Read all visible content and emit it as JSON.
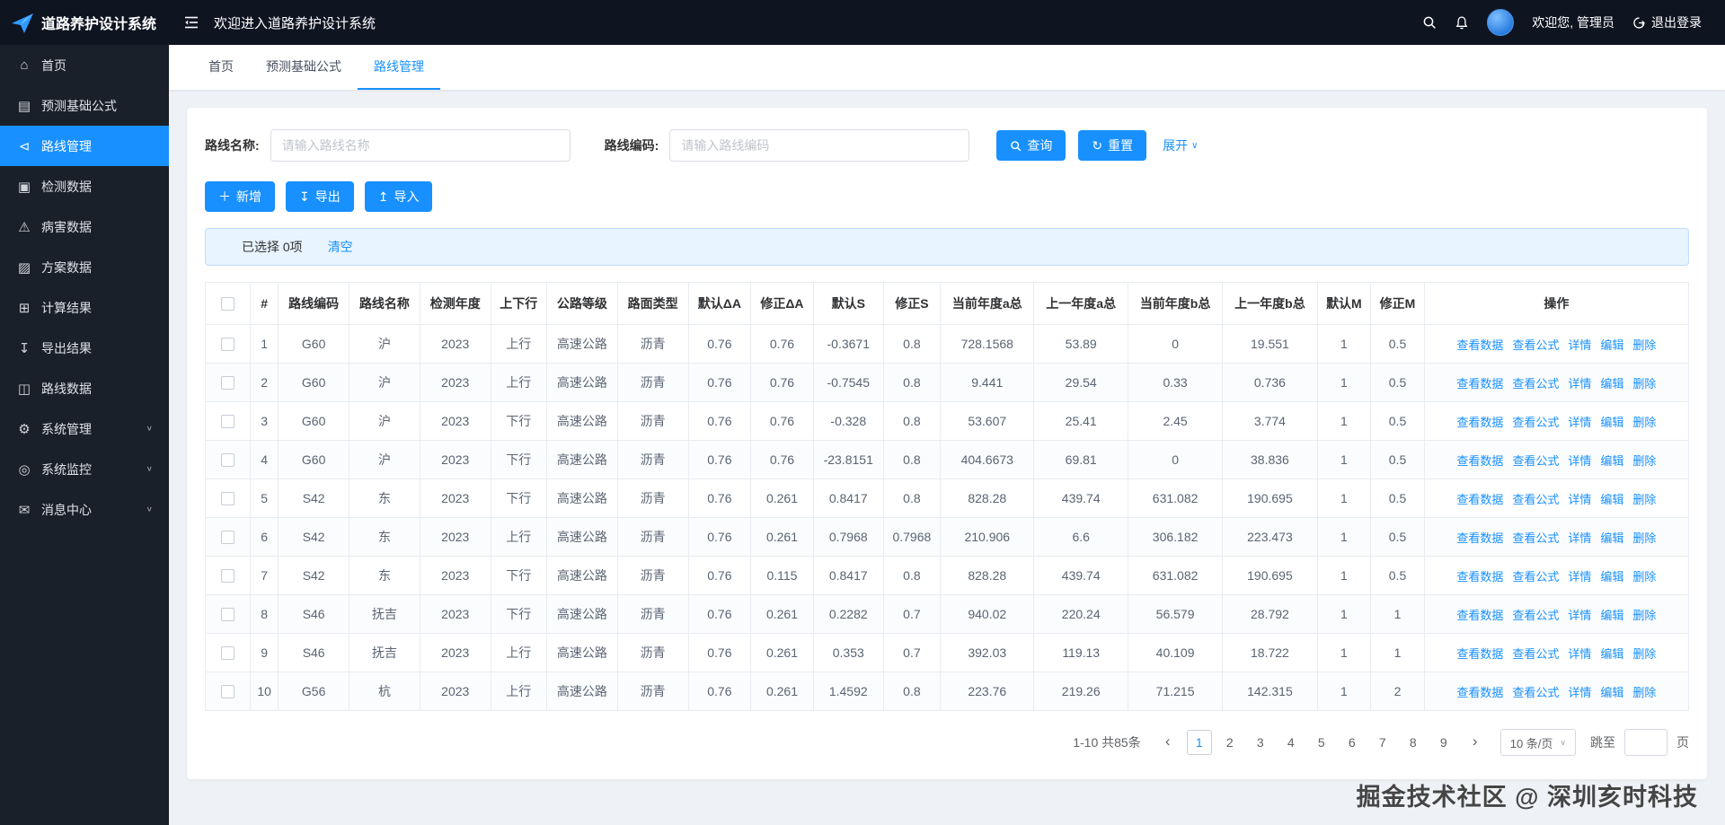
{
  "app": {
    "title": "道路养护设计系统",
    "welcome": "欢迎进入道路养护设计系统",
    "greeting": "欢迎您, 管理员",
    "logout_label": "退出登录"
  },
  "sidebar": {
    "items": [
      {
        "id": "home",
        "label": "首页",
        "icon": "home-icon",
        "glyph": "⌂"
      },
      {
        "id": "formula",
        "label": "预测基础公式",
        "icon": "formula-icon",
        "glyph": "▤"
      },
      {
        "id": "route-mgmt",
        "label": "路线管理",
        "icon": "route-icon",
        "glyph": "⊲",
        "active": true
      },
      {
        "id": "detection",
        "label": "检测数据",
        "icon": "detection-icon",
        "glyph": "▣"
      },
      {
        "id": "disease",
        "label": "病害数据",
        "icon": "disease-icon",
        "glyph": "⚠"
      },
      {
        "id": "plan",
        "label": "方案数据",
        "icon": "plan-icon",
        "glyph": "▨"
      },
      {
        "id": "calc-result",
        "label": "计算结果",
        "icon": "calc-icon",
        "glyph": "⊞"
      },
      {
        "id": "export-result",
        "label": "导出结果",
        "icon": "export-icon",
        "glyph": "↧"
      },
      {
        "id": "route-data",
        "label": "路线数据",
        "icon": "route-data-icon",
        "glyph": "◫"
      },
      {
        "id": "sys-mgmt",
        "label": "系统管理",
        "icon": "gear-icon",
        "glyph": "⚙",
        "expandable": true
      },
      {
        "id": "sys-monitor",
        "label": "系统监控",
        "icon": "monitor-icon",
        "glyph": "◎",
        "expandable": true
      },
      {
        "id": "message-center",
        "label": "消息中心",
        "icon": "message-icon",
        "glyph": "✉",
        "expandable": true
      }
    ]
  },
  "tabs": [
    {
      "label": "首页"
    },
    {
      "label": "预测基础公式"
    },
    {
      "label": "路线管理",
      "active": true
    }
  ],
  "filters": {
    "name_label": "路线名称:",
    "name_placeholder": "请输入路线名称",
    "code_label": "路线编码:",
    "code_placeholder": "请输入路线编码",
    "search_label": "查询",
    "reset_label": "重置",
    "expand_label": "展开"
  },
  "toolbar": {
    "add_label": "新增",
    "export_label": "导出",
    "import_label": "导入"
  },
  "selection": {
    "text": "已选择 0项",
    "clear_label": "清空"
  },
  "table": {
    "headers": [
      "#",
      "路线编码",
      "路线名称",
      "检测年度",
      "上下行",
      "公路等级",
      "路面类型",
      "默认ΔA",
      "修正ΔA",
      "默认S",
      "修正S",
      "当前年度a总",
      "上一年度a总",
      "当前年度b总",
      "上一年度b总",
      "默认M",
      "修正M",
      "操作"
    ],
    "actions": [
      "查看数据",
      "查看公式",
      "详情",
      "编辑",
      "删除"
    ],
    "action_names": [
      "view-data-link",
      "view-formula-link",
      "detail-link",
      "edit-link",
      "delete-link"
    ],
    "rows": [
      [
        "1",
        "G60",
        "沪",
        "2023",
        "上行",
        "高速公路",
        "沥青",
        "0.76",
        "0.76",
        "-0.3671",
        "0.8",
        "728.1568",
        "53.89",
        "0",
        "19.551",
        "1",
        "0.5"
      ],
      [
        "2",
        "G60",
        "沪",
        "2023",
        "上行",
        "高速公路",
        "沥青",
        "0.76",
        "0.76",
        "-0.7545",
        "0.8",
        "9.441",
        "29.54",
        "0.33",
        "0.736",
        "1",
        "0.5"
      ],
      [
        "3",
        "G60",
        "沪",
        "2023",
        "下行",
        "高速公路",
        "沥青",
        "0.76",
        "0.76",
        "-0.328",
        "0.8",
        "53.607",
        "25.41",
        "2.45",
        "3.774",
        "1",
        "0.5"
      ],
      [
        "4",
        "G60",
        "沪",
        "2023",
        "下行",
        "高速公路",
        "沥青",
        "0.76",
        "0.76",
        "-23.8151",
        "0.8",
        "404.6673",
        "69.81",
        "0",
        "38.836",
        "1",
        "0.5"
      ],
      [
        "5",
        "S42",
        "东",
        "2023",
        "下行",
        "高速公路",
        "沥青",
        "0.76",
        "0.261",
        "0.8417",
        "0.8",
        "828.28",
        "439.74",
        "631.082",
        "190.695",
        "1",
        "0.5"
      ],
      [
        "6",
        "S42",
        "东",
        "2023",
        "上行",
        "高速公路",
        "沥青",
        "0.76",
        "0.261",
        "0.7968",
        "0.7968",
        "210.906",
        "6.6",
        "306.182",
        "223.473",
        "1",
        "0.5"
      ],
      [
        "7",
        "S42",
        "东",
        "2023",
        "下行",
        "高速公路",
        "沥青",
        "0.76",
        "0.115",
        "0.8417",
        "0.8",
        "828.28",
        "439.74",
        "631.082",
        "190.695",
        "1",
        "0.5"
      ],
      [
        "8",
        "S46",
        "抚吉",
        "2023",
        "下行",
        "高速公路",
        "沥青",
        "0.76",
        "0.261",
        "0.2282",
        "0.7",
        "940.02",
        "220.24",
        "56.579",
        "28.792",
        "1",
        "1"
      ],
      [
        "9",
        "S46",
        "抚吉",
        "2023",
        "上行",
        "高速公路",
        "沥青",
        "0.76",
        "0.261",
        "0.353",
        "0.7",
        "392.03",
        "119.13",
        "40.109",
        "18.722",
        "1",
        "1"
      ],
      [
        "10",
        "G56",
        "杭",
        "2023",
        "上行",
        "高速公路",
        "沥青",
        "0.76",
        "0.261",
        "1.4592",
        "0.8",
        "223.76",
        "219.26",
        "71.215",
        "142.315",
        "1",
        "2"
      ]
    ]
  },
  "pagination": {
    "total_text": "1-10 共85条",
    "prev_glyph": "‹",
    "next_glyph": "›",
    "pages": [
      "1",
      "2",
      "3",
      "4",
      "5",
      "6",
      "7",
      "8",
      "9"
    ],
    "current": "1",
    "page_size": "10 条/页",
    "jump_label": "跳至",
    "jump_suffix": "页"
  },
  "watermark": "掘金技术社区 @ 深圳亥时科技",
  "colors": {
    "accent": "#1890ff",
    "header_bg": "#0f1421",
    "sidebar_bg": "#1a2029"
  }
}
